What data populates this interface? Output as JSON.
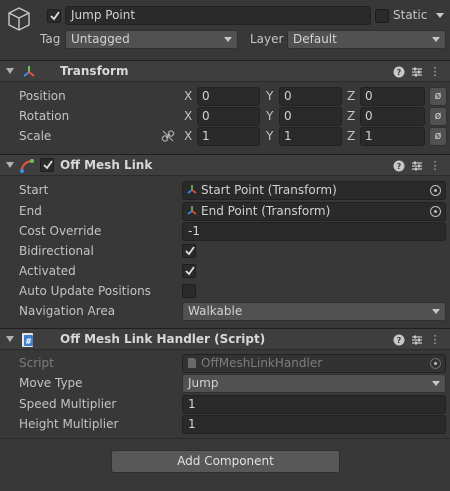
{
  "gameobject": {
    "name": "Jump Point",
    "active": true,
    "static_label": "Static",
    "tag_label": "Tag",
    "tag_value": "Untagged",
    "layer_label": "Layer",
    "layer_value": "Default"
  },
  "transform": {
    "title": "Transform",
    "rows": [
      {
        "label": "Position",
        "x": "0",
        "y": "0",
        "z": "0"
      },
      {
        "label": "Rotation",
        "x": "0",
        "y": "0",
        "z": "0"
      },
      {
        "label": "Scale",
        "x": "1",
        "y": "1",
        "z": "1"
      }
    ],
    "axis": {
      "x": "X",
      "y": "Y",
      "z": "Z"
    },
    "reset_symbol": "ø"
  },
  "offmeshlink": {
    "title": "Off Mesh Link",
    "enabled": true,
    "start_label": "Start",
    "start_value": "Start Point (Transform)",
    "end_label": "End",
    "end_value": "End Point (Transform)",
    "cost_label": "Cost Override",
    "cost_value": "-1",
    "bidirectional_label": "Bidirectional",
    "bidirectional": true,
    "activated_label": "Activated",
    "activated": true,
    "auto_update_label": "Auto Update Positions",
    "auto_update": false,
    "nav_area_label": "Navigation Area",
    "nav_area_value": "Walkable"
  },
  "handler": {
    "title": "Off Mesh Link Handler (Script)",
    "script_label": "Script",
    "script_value": "OffMeshLinkHandler",
    "move_type_label": "Move Type",
    "move_type_value": "Jump",
    "speed_label": "Speed Multiplier",
    "speed_value": "1",
    "height_label": "Height Multiplier",
    "height_value": "1"
  },
  "add_component_label": "Add Component",
  "colors": {
    "background": "#383838",
    "header": "#3e3e3e",
    "field": "#2a2a2a"
  }
}
